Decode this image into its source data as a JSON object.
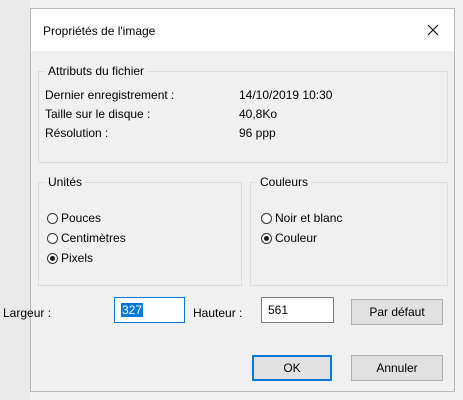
{
  "dialog": {
    "title": "Propriétés de l'image",
    "close_icon": "close-icon"
  },
  "file_attributes": {
    "legend": "Attributs du fichier",
    "rows": [
      {
        "label": "Dernier enregistrement :",
        "value": "14/10/2019 10:30"
      },
      {
        "label": "Taille sur le disque :",
        "value": "40,8Ko"
      },
      {
        "label": "Résolution :",
        "value": "96 ppp"
      }
    ]
  },
  "units": {
    "legend": "Unités",
    "options": [
      {
        "label": "Pouces",
        "checked": false
      },
      {
        "label": "Centimètres",
        "checked": false
      },
      {
        "label": "Pixels",
        "checked": true
      }
    ]
  },
  "colors": {
    "legend": "Couleurs",
    "options": [
      {
        "label": "Noir et blanc",
        "checked": false
      },
      {
        "label": "Couleur",
        "checked": true
      }
    ]
  },
  "size": {
    "width_label": "Largeur :",
    "width_value": "327",
    "height_label": "Hauteur :",
    "height_value": "561",
    "default_button": "Par défaut"
  },
  "actions": {
    "ok": "OK",
    "cancel": "Annuler"
  },
  "theme": {
    "accent": "#0078d7",
    "dialog_bg": "#f0f0f0",
    "titlebar_bg": "#ffffff"
  }
}
